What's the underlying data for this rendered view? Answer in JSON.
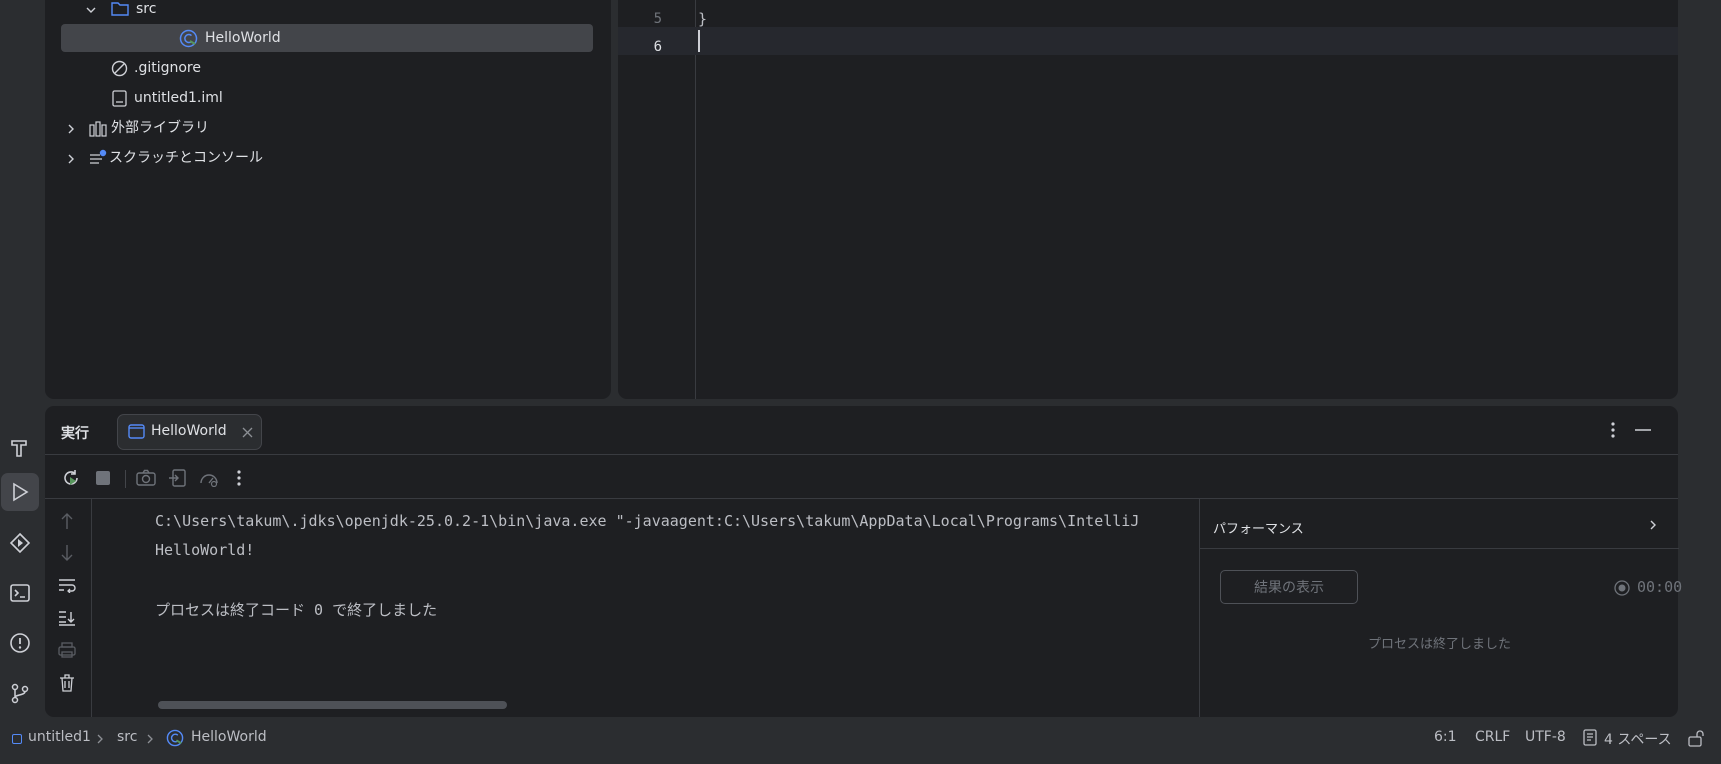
{
  "project_tree": {
    "items": [
      {
        "label": "src",
        "icon": "folder-icon"
      },
      {
        "label": "HelloWorld",
        "icon": "java-class-icon"
      },
      {
        "label": ".gitignore",
        "icon": "ignore-file-icon"
      },
      {
        "label": "untitled1.iml",
        "icon": "iml-file-icon"
      },
      {
        "label": "外部ライブラリ",
        "icon": "library-icon"
      },
      {
        "label": "スクラッチとコンソール",
        "icon": "scratch-icon"
      }
    ]
  },
  "editor": {
    "lines": [
      {
        "num": "5",
        "text": "}"
      },
      {
        "num": "6",
        "text": ""
      }
    ]
  },
  "run_panel": {
    "title": "実行",
    "tab_label": "HelloWorld",
    "console_lines": [
      "C:\\Users\\takum\\.jdks\\openjdk-25.0.2-1\\bin\\java.exe \"-javaagent:C:\\Users\\takum\\AppData\\Local\\Programs\\IntelliJ",
      "HelloWorld!",
      "",
      "プロセスは終了コード 0 で終了しました"
    ],
    "performance": {
      "title": "パフォーマンス",
      "show_results_label": "結果の表示",
      "timer": "00:00",
      "status": "プロセスは終了しました"
    }
  },
  "status_bar": {
    "breadcrumb": [
      "untitled1",
      "src",
      "HelloWorld"
    ],
    "position": "6:1",
    "line_sep": "CRLF",
    "encoding": "UTF-8",
    "indent": "4 スペース"
  },
  "colors": {
    "accent": "#3574f0",
    "background": "#2b2d30",
    "panel": "#1e1f22",
    "selection": "#43454a"
  }
}
